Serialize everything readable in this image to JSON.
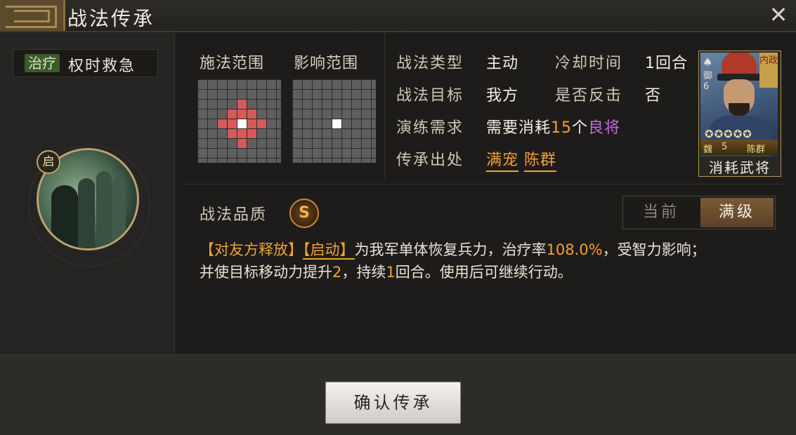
{
  "window": {
    "title": "战法传承",
    "close_label": "✕"
  },
  "skill": {
    "tag": "治疗",
    "name": "权时救急",
    "icon_badge": "启"
  },
  "ranges": {
    "cast_label": "施法范围",
    "effect_label": "影响范围"
  },
  "info": {
    "type_key": "战法类型",
    "type_val": "主动",
    "cooldown_key": "冷却时间",
    "cooldown_val": "1回合",
    "target_key": "战法目标",
    "target_val": "我方",
    "counter_key": "是否反击",
    "counter_val": "否",
    "train_key": "演练需求",
    "train_prefix": "需要消耗",
    "train_count": "15",
    "train_unit": "个",
    "train_grade": "良将",
    "source_key": "传承出处",
    "source_1": "满宠",
    "source_2": "陈群"
  },
  "card": {
    "corner": "内政",
    "tag": "御6",
    "stars": "✪✪✪✪✪",
    "faction": "魏",
    "level": "5",
    "name": "陈群",
    "label": "消耗武将"
  },
  "quality": {
    "label": "战法品质",
    "grade": "S"
  },
  "toggle": {
    "current": "当前",
    "max": "满级"
  },
  "description": {
    "tag1": "【对友方释放】",
    "tag2": "【启动】",
    "part1": "为我军单体恢复兵力，治疗率",
    "rate": "108.0%",
    "part2": "，受智力影响；",
    "part3": "并使目标移动力提升",
    "move": "2",
    "part4": "，持续",
    "turns": "1",
    "part5": "回合。使用后可继续行动。"
  },
  "confirm_button": "确认传承",
  "colors": {
    "accent_orange": "#f2a233",
    "grade_purple": "#c36ae0",
    "grid_red": "#d65a5a",
    "grid_gray": "#5f5f5f"
  }
}
